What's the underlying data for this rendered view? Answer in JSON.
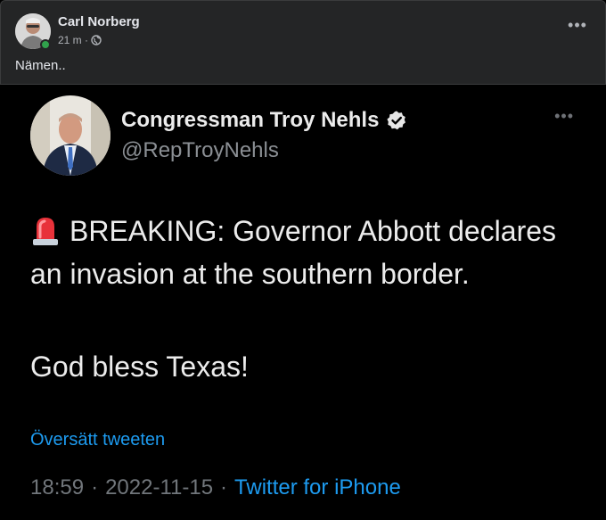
{
  "facebook_post": {
    "author": "Carl Norberg",
    "time": "21 m ·",
    "audience_icon": "globe-icon",
    "more_icon": "more-icon",
    "text": "Nämen.."
  },
  "tweet": {
    "display_name": "Congressman Troy Nehls",
    "handle": "@RepTroyNehls",
    "verified_icon": "verified-badge-icon",
    "siren_icon": "siren-icon",
    "body_line1": "BREAKING: Governor Abbott declares an invasion at the southern border.",
    "body_line2": "God bless Texas!",
    "translate_link": "Översätt tweeten",
    "time": "18:59",
    "separator": "·",
    "date": "2022-11-15",
    "source": "Twitter for iPhone"
  },
  "colors": {
    "fb_background": "#242526",
    "tweet_background": "#000000",
    "link_blue": "#1d9bf0",
    "online_green": "#31a24c"
  }
}
